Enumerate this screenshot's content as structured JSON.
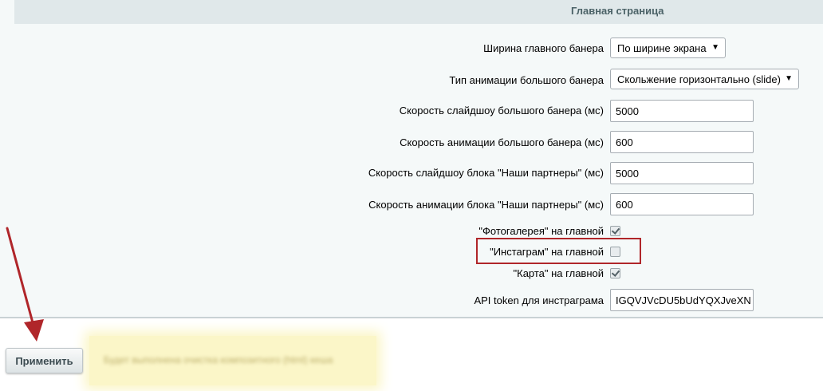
{
  "section": {
    "title": "Главная страница"
  },
  "rows": {
    "banner_width": {
      "label": "Ширина главного банера",
      "value": "По ширине экрана"
    },
    "animation_type": {
      "label": "Тип анимации большого банера",
      "value": "Скольжение горизонтально (slide)"
    },
    "slideshow_speed": {
      "label": "Скорость слайдшоу большого банера (мс)",
      "value": "5000"
    },
    "animation_speed": {
      "label": "Скорость анимации большого банера (мс)",
      "value": "600"
    },
    "partners_slideshow_speed": {
      "label": "Скорость слайдшоу блока \"Наши партнеры\" (мс)",
      "value": "5000"
    },
    "partners_animation_speed": {
      "label": "Скорость анимации блока \"Наши партнеры\" (мс)",
      "value": "600"
    },
    "photogallery": {
      "label": "\"Фотогалерея\" на главной",
      "checked": true
    },
    "instagram": {
      "label": "\"Инстаграм\" на главной",
      "checked": false
    },
    "map": {
      "label": "\"Карта\" на главной",
      "checked": true
    },
    "api_token": {
      "label": "API token для инстраграма",
      "value": "IGQVJVcDU5bUdYQXJveXN"
    }
  },
  "footer": {
    "apply_label": "Применить",
    "notice_text": "Будет выполнена очистка композитного (html) кеша"
  },
  "colors": {
    "panel_bg": "#f5f9f9",
    "section_head_bg": "#e0e8ea",
    "highlight": "#b0262a",
    "arrow": "#b0262a",
    "notice_bg": "#fbf6c8"
  }
}
